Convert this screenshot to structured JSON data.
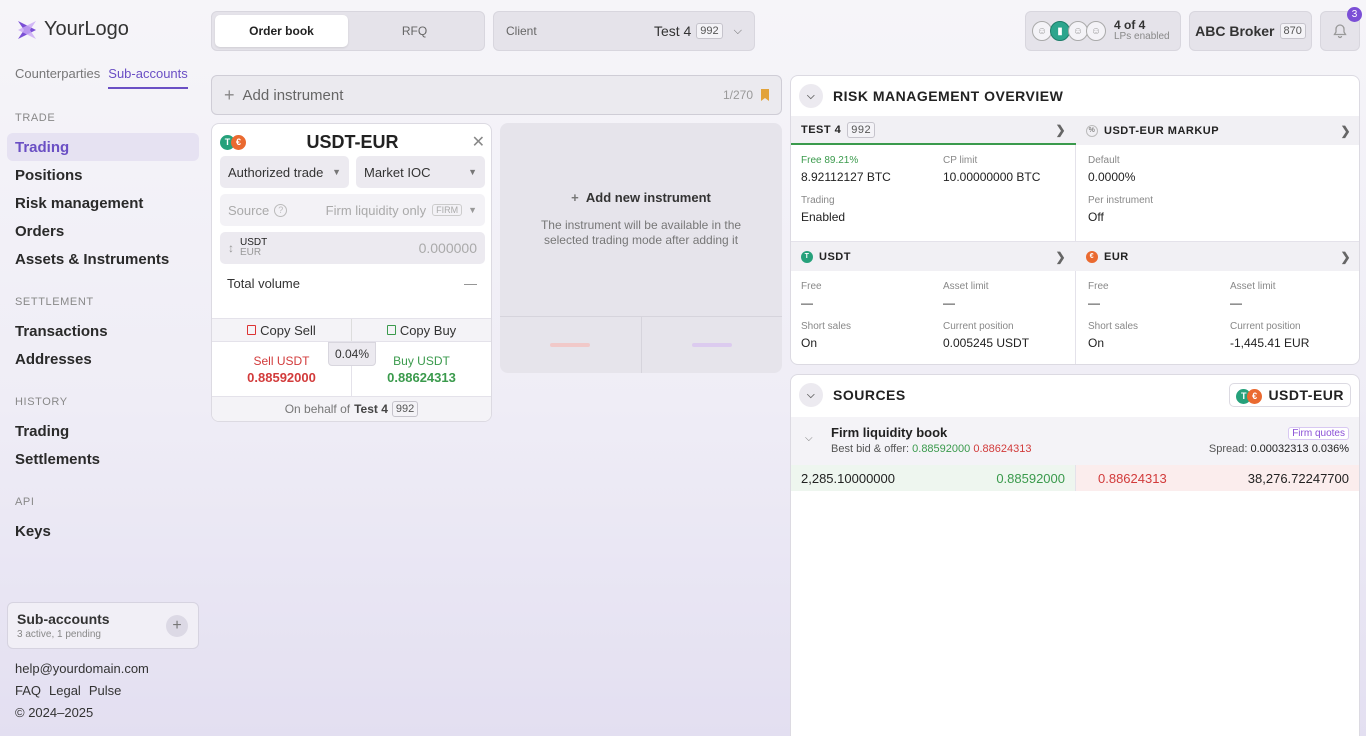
{
  "sidebar": {
    "logo": "YourLogo",
    "tabs": [
      "Counterparties",
      "Sub-accounts"
    ],
    "sections": {
      "trade": "TRADE",
      "settlement": "SETTLEMENT",
      "history": "HISTORY",
      "api": "API"
    },
    "trade_items": [
      "Trading",
      "Positions",
      "Risk management",
      "Orders",
      "Assets & Instruments"
    ],
    "settlement_items": [
      "Transactions",
      "Addresses"
    ],
    "history_items": [
      "Trading",
      "Settlements"
    ],
    "api_items": [
      "Keys"
    ],
    "subaccounts": {
      "title": "Sub-accounts",
      "subtitle": "3 active, 1 pending"
    },
    "footer": {
      "email": "help@yourdomain.com",
      "links": [
        "FAQ",
        "Legal",
        "Pulse"
      ],
      "copyright": "© 2024–2025"
    }
  },
  "header": {
    "modes": [
      "Order book",
      "RFQ"
    ],
    "client_label": "Client",
    "client_name": "Test 4",
    "client_id": "992",
    "lps_count": "4 of 4",
    "lps_label": "LPs enabled",
    "broker_name": "ABC Broker",
    "broker_id": "870",
    "notifications": "3"
  },
  "add_instrument": {
    "placeholder": "Add instrument",
    "count": "1/270"
  },
  "instrument_card": {
    "pair": "USDT-EUR",
    "order_type": "Authorized trade",
    "exec_type": "Market IOC",
    "source_label": "Source",
    "source_value": "Firm liquidity only",
    "source_tag": "FIRM",
    "qty_base": "USDT",
    "qty_quote": "EUR",
    "qty_placeholder": "0.000000",
    "total_volume_label": "Total volume",
    "total_volume_value": "—",
    "copy_sell": "Copy Sell",
    "copy_buy": "Copy Buy",
    "sell_label": "Sell USDT",
    "sell_price": "0.88592000",
    "buy_label": "Buy USDT",
    "buy_price": "0.88624313",
    "spread": "0.04%",
    "behalf_label": "On behalf of",
    "behalf_name": "Test 4",
    "behalf_id": "992"
  },
  "new_instrument": {
    "title": "Add new instrument",
    "desc": "The instrument will be available in the selected trading mode after adding it"
  },
  "risk": {
    "title": "RISK MANAGEMENT OVERVIEW",
    "client_cell": {
      "title": "TEST 4",
      "id": "992",
      "free_label": "Free 89.21%",
      "free_value": "8.92112127 BTC",
      "cp_label": "CP limit",
      "cp_value": "10.00000000 BTC",
      "trading_label": "Trading",
      "trading_value": "Enabled"
    },
    "markup_cell": {
      "title": "USDT-EUR MARKUP",
      "default_label": "Default",
      "default_value": "0.0000%",
      "per_label": "Per instrument",
      "per_value": "Off"
    },
    "usdt_cell": {
      "title": "USDT",
      "free_label": "Free",
      "free_value": "—",
      "limit_label": "Asset limit",
      "limit_value": "—",
      "short_label": "Short sales",
      "short_value": "On",
      "pos_label": "Current position",
      "pos_value": "0.005245 USDT"
    },
    "eur_cell": {
      "title": "EUR",
      "free_label": "Free",
      "free_value": "—",
      "limit_label": "Asset limit",
      "limit_value": "—",
      "short_label": "Short sales",
      "short_value": "On",
      "pos_label": "Current position",
      "pos_value": "-1,445.41 EUR"
    }
  },
  "sources": {
    "title": "SOURCES",
    "pair": "USDT-EUR",
    "book_title": "Firm liquidity book",
    "best_label": "Best bid & offer:",
    "best_bid": "0.88592000",
    "best_ask": "0.88624313",
    "quote_tag": "Firm quotes",
    "spread_label": "Spread:",
    "spread_abs": "0.00032313",
    "spread_pct": "0.036%",
    "row": {
      "bid_qty": "2,285.10000000",
      "bid_price": "0.88592000",
      "ask_price": "0.88624313",
      "ask_qty": "38,276.72247700"
    }
  },
  "colors": {
    "accent": "#6a4fc4",
    "buy": "#3a9a4c",
    "sell": "#d23b3b",
    "usdt": "#26a17b",
    "eur": "#ea6a30"
  },
  "icons": [
    "logo-icon",
    "plus-icon",
    "bookmark-icon",
    "close-icon",
    "chevron-down-icon",
    "chevron-right-icon",
    "bell-icon",
    "copy-icon",
    "question-icon",
    "sort-icon",
    "markup-icon"
  ]
}
